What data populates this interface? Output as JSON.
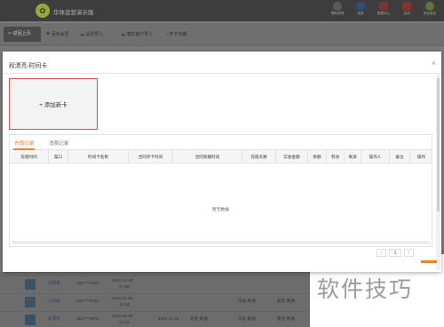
{
  "app": {
    "brand": "华体运营演示版"
  },
  "top_icons": [
    {
      "name": "help-icon",
      "label": "帮助说明",
      "color": "#5a5a5a"
    },
    {
      "name": "user-icon",
      "label": "系统",
      "color": "#2f4f7a"
    },
    {
      "name": "shield-icon",
      "label": "数据中心",
      "color": "#7a3434"
    },
    {
      "name": "gift-icon",
      "label": "活动",
      "color": "#8b2e2e"
    },
    {
      "name": "logout-icon",
      "label": "安全退出",
      "color": "#5a7a2e"
    }
  ],
  "toolbar": {
    "back": "返回上页",
    "add_member": "添加会员",
    "import_members": "会员导入",
    "import_customers": "潜在客户导入",
    "card_expiry": "开卡日期"
  },
  "modal": {
    "title": "段漂亮-时间卡",
    "close": "×",
    "add_card": "+ 添加新卡",
    "tabs": [
      "充值记录",
      "消费记录"
    ],
    "columns": [
      "充值时间",
      "渠口",
      "时间卡名称",
      "合同开卡时间",
      "合同到期时间",
      "充值天数",
      "实收金额",
      "余额",
      "有效",
      "来源",
      "操作人",
      "备注",
      "操作"
    ],
    "empty_text": "暂无数据",
    "pager": {
      "prev": "‹",
      "current": "1",
      "next": "›"
    }
  },
  "background_rows": [
    {
      "name": "测测看",
      "phone": "156****5253",
      "date": "2020-12-28",
      "time": "17:45",
      "col5": "-",
      "col6": "-"
    },
    {
      "name": "小时候",
      "phone": "156****5254",
      "date": "2020-11-06",
      "time": "14:44",
      "col5": "-",
      "col6": "-",
      "status": "冯总·断通",
      "status2": "新宸·断通"
    },
    {
      "name": "段漂亮",
      "phone": "154****8872",
      "date": "2020-11-06",
      "time": "14:12",
      "col5": "2020-11-10",
      "col6": "新宸·断通",
      "status": "冯总·断通",
      "status2": "新宸·断通"
    }
  ],
  "watermark": "软件技巧"
}
